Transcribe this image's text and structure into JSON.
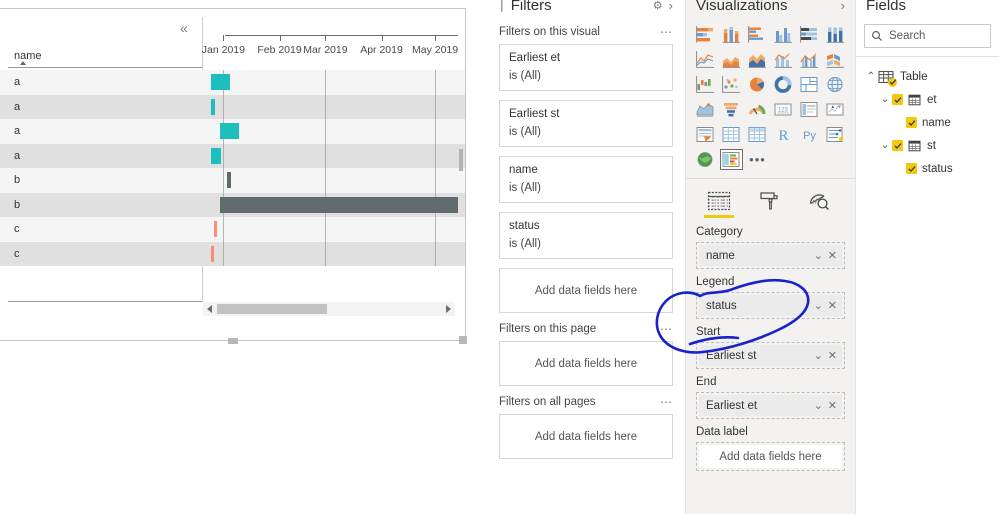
{
  "canvas": {
    "visual": {
      "type": "gantt",
      "category_header": "name",
      "collapse_icon": "chevron-double-left-icon",
      "sort_indicator": "sort-ascending-arrow",
      "rows": [
        {
          "name": "a",
          "status": "teal",
          "start_pct": 3.0,
          "width_pct": 7.5
        },
        {
          "name": "a",
          "status": "teal",
          "start_pct": 3.0,
          "width_pct": 1.6
        },
        {
          "name": "a",
          "status": "teal",
          "start_pct": 6.5,
          "width_pct": 7.5
        },
        {
          "name": "a",
          "status": "teal",
          "start_pct": 3.0,
          "width_pct": 4.0
        },
        {
          "name": "b",
          "status": "gray",
          "start_pct": 9.5,
          "width_pct": 1.6
        },
        {
          "name": "b",
          "status": "gray",
          "start_pct": 6.6,
          "width_pct": 93.4
        },
        {
          "name": "c",
          "status": "salmon",
          "start_pct": 4.2,
          "width_pct": 1.3
        },
        {
          "name": "c",
          "status": "salmon",
          "start_pct": 3.0,
          "width_pct": 1.5
        }
      ],
      "axis_labels": [
        "Jan 2019",
        "Feb 2019",
        "Mar 2019",
        "Apr 2019",
        "May 2019"
      ],
      "axis_positions_pct": [
        8.0,
        30.0,
        48.0,
        70.0,
        91.0
      ],
      "gridlines_pct": [
        8.0,
        48.0,
        91.0
      ],
      "status_colors": {
        "teal": "#1CBFBB",
        "gray": "#5F6B6D",
        "salmon": "#FB8B72"
      },
      "row_band_colors": {
        "odd": "#f5f5f5",
        "even": "#e0e0e0"
      },
      "hscroll": {
        "left_arrow": "scroll-left-arrow",
        "right_arrow": "scroll-right-arrow"
      }
    }
  },
  "filters": {
    "title": "Filters",
    "pin_icon": "filter-pin-icon",
    "settings_icon": "settings-gear-icon",
    "collapse_icon": "chevron-right-icon",
    "groups": [
      {
        "heading": "Filters on this visual",
        "menu_icon": "more-options-ellipsis",
        "cards": [
          {
            "field": "Earliest et",
            "condition": "is (All)"
          },
          {
            "field": "Earliest st",
            "condition": "is (All)"
          },
          {
            "field": "name",
            "condition": "is (All)"
          },
          {
            "field": "status",
            "condition": "is (All)"
          }
        ],
        "dropzone": "Add data fields here"
      },
      {
        "heading": "Filters on this page",
        "menu_icon": "more-options-ellipsis",
        "cards": [],
        "dropzone": "Add data fields here"
      },
      {
        "heading": "Filters on all pages",
        "menu_icon": "more-options-ellipsis",
        "cards": [],
        "dropzone": "Add data fields here"
      }
    ]
  },
  "visualizations": {
    "title": "Visualizations",
    "collapse_icon": "chevron-right-icon",
    "gallery": [
      "stacked-bar-chart-icon",
      "stacked-column-chart-icon",
      "clustered-bar-chart-icon",
      "clustered-column-chart-icon",
      "100-stacked-bar-chart-icon",
      "100-stacked-column-chart-icon",
      "line-chart-icon",
      "area-chart-icon",
      "stacked-area-chart-icon",
      "line-and-stacked-column-chart-icon",
      "line-and-clustered-column-chart-icon",
      "ribbon-chart-icon",
      "waterfall-chart-icon",
      "scatter-chart-icon",
      "pie-chart-icon",
      "donut-chart-icon",
      "treemap-icon",
      "map-icon",
      "filled-map-icon",
      "funnel-icon",
      "gauge-icon",
      "card-icon",
      "multi-row-card-icon",
      "kpi-icon",
      "slicer-icon",
      "table-icon",
      "matrix-icon",
      "r-script-visual-icon",
      "python-visual-icon",
      "key-influencers-icon",
      "arcgis-map-icon",
      "gantt-custom-visual-icon",
      "more-visuals-ellipsis"
    ],
    "selected_gallery_index": 31,
    "tabs": [
      {
        "name": "fields-tab",
        "icon": "fields-grid-icon",
        "active": true
      },
      {
        "name": "format-tab",
        "icon": "paint-roller-icon",
        "active": false
      },
      {
        "name": "analytics-tab",
        "icon": "analytics-magnifier-icon",
        "active": false
      }
    ],
    "wells": [
      {
        "label": "Category",
        "value": "name",
        "empty_text": null
      },
      {
        "label": "Legend",
        "value": "status",
        "empty_text": null
      },
      {
        "label": "Start",
        "value": "Earliest st",
        "empty_text": null
      },
      {
        "label": "End",
        "value": "Earliest et",
        "empty_text": null
      },
      {
        "label": "Data label",
        "value": null,
        "empty_text": "Add data fields here"
      }
    ],
    "well_dropdown_icon": "chevron-down-icon",
    "well_remove_icon": "remove-field-x-icon"
  },
  "fields": {
    "title": "Fields",
    "search": {
      "icon": "search-icon",
      "placeholder": "Search",
      "value": ""
    },
    "tree": [
      {
        "label": "Table",
        "level": 0,
        "twisty": "collapse-caret-up",
        "icon": "table-icon",
        "checked": true,
        "badge": true
      },
      {
        "label": "et",
        "level": 1,
        "twisty": "expand-caret-down",
        "icon": "calendar-icon",
        "checked": true,
        "badge": false
      },
      {
        "label": "name",
        "level": 2,
        "twisty": null,
        "icon": null,
        "checked": true,
        "badge": false
      },
      {
        "label": "st",
        "level": 1,
        "twisty": "expand-caret-down",
        "icon": "calendar-icon",
        "checked": true,
        "badge": false
      },
      {
        "label": "status",
        "level": 2,
        "twisty": null,
        "icon": null,
        "checked": true,
        "badge": false
      }
    ]
  },
  "annotation": {
    "type": "hand-drawn-ellipse",
    "color": "#1822C8",
    "target": "legend-well-status"
  }
}
